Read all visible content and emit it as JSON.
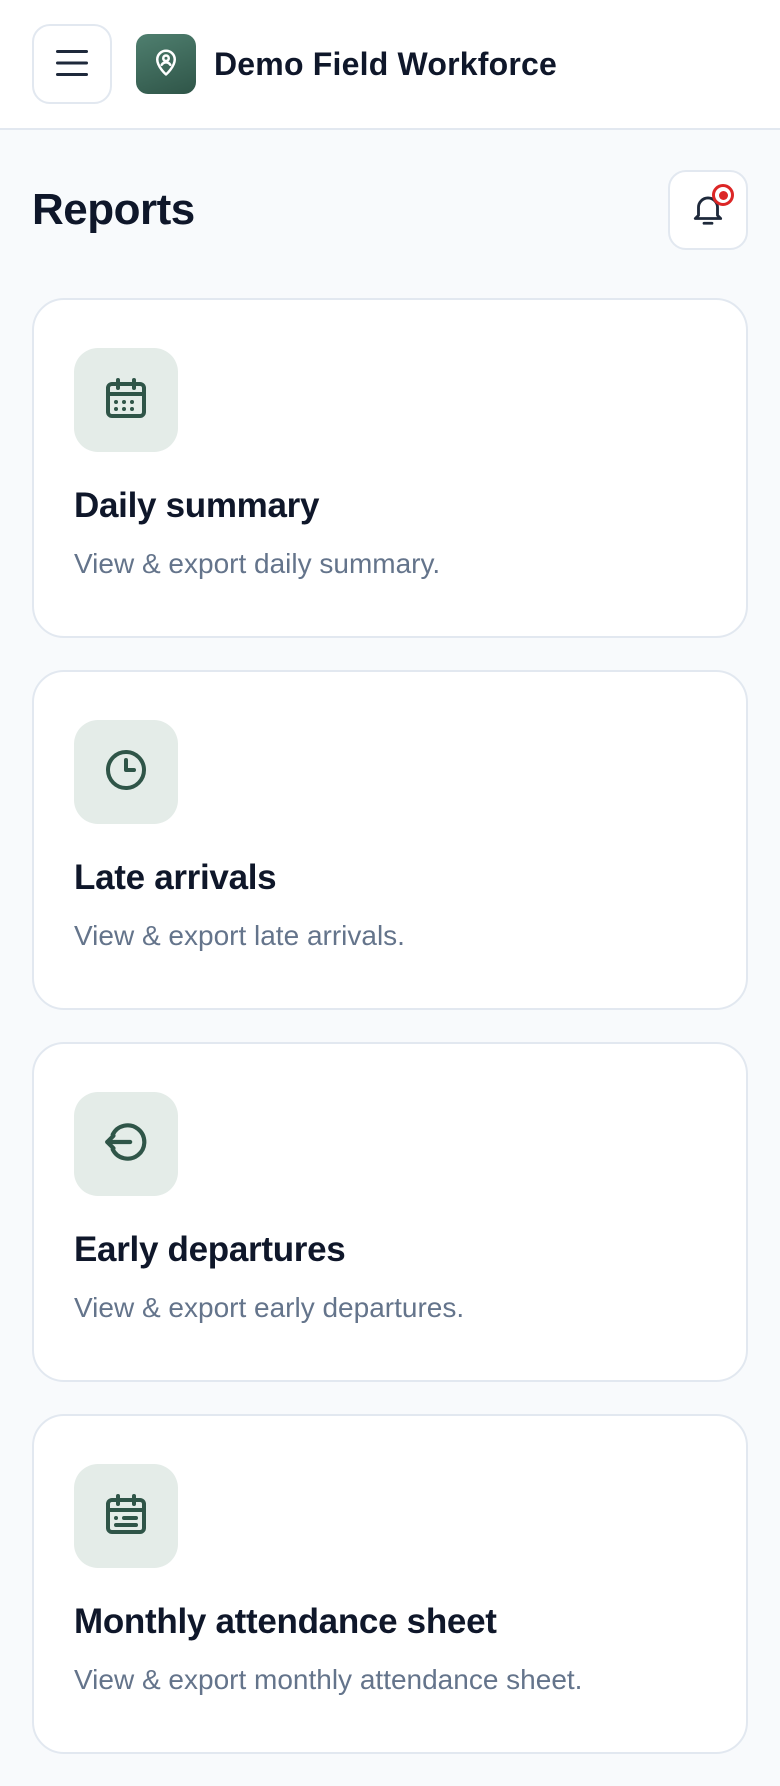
{
  "app": {
    "title": "Demo Field Workforce",
    "logo_icon": "map-pin-user-icon",
    "menu_icon": "hamburger-menu-icon"
  },
  "colors": {
    "accent": "#2f5548",
    "icon_tile_bg": "#e4ece8",
    "notification_dot": "#dc2626",
    "muted_text": "#64748b"
  },
  "page": {
    "title": "Reports",
    "notification_icon": "bell-icon"
  },
  "reports": [
    {
      "icon": "calendar-icon",
      "title": "Daily summary",
      "description": "View & export daily summary."
    },
    {
      "icon": "clock-icon",
      "title": "Late arrivals",
      "description": "View & export late arrivals."
    },
    {
      "icon": "exit-arrow-icon",
      "title": "Early departures",
      "description": "View & export early departures."
    },
    {
      "icon": "calendar-sheet-icon",
      "title": "Monthly attendance sheet",
      "description": "View & export monthly attendance sheet."
    }
  ]
}
